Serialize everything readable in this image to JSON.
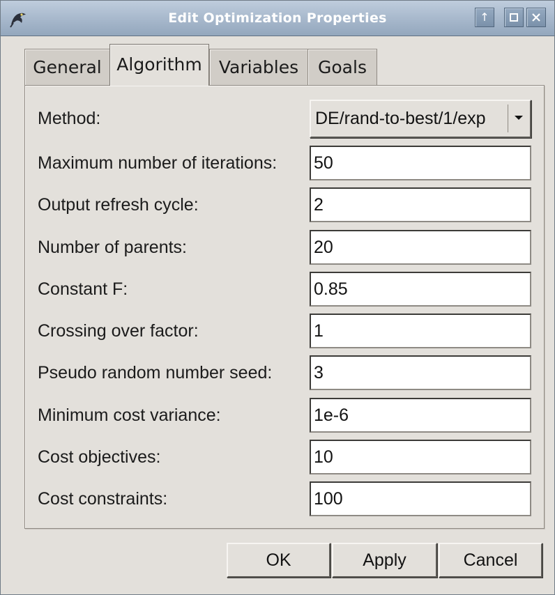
{
  "window": {
    "title": "Edit Optimization Properties",
    "icons": [
      "app-icon",
      "shade-up-icon",
      "maximize-icon",
      "close-icon"
    ]
  },
  "tabs": [
    {
      "label": "General",
      "active": false
    },
    {
      "label": "Algorithm",
      "active": true
    },
    {
      "label": "Variables",
      "active": false
    },
    {
      "label": "Goals",
      "active": false
    }
  ],
  "form": {
    "method": {
      "label": "Method:",
      "value": "DE/rand-to-best/1/exp"
    },
    "fields": [
      {
        "label": "Maximum number of iterations:",
        "value": "50"
      },
      {
        "label": "Output refresh cycle:",
        "value": "2"
      },
      {
        "label": "Number of parents:",
        "value": "20"
      },
      {
        "label": "Constant F:",
        "value": "0.85"
      },
      {
        "label": "Crossing over factor:",
        "value": "1"
      },
      {
        "label": "Pseudo random number seed:",
        "value": "3"
      },
      {
        "label": "Minimum cost variance:",
        "value": "1e-6"
      },
      {
        "label": "Cost objectives:",
        "value": "10"
      },
      {
        "label": "Cost constraints:",
        "value": "100"
      }
    ]
  },
  "buttons": {
    "ok": "OK",
    "apply": "Apply",
    "cancel": "Cancel"
  },
  "colors": {
    "titlebar": "#a6b7cb",
    "dialog_background": "#e3e0db",
    "field_background": "#ffffff"
  }
}
